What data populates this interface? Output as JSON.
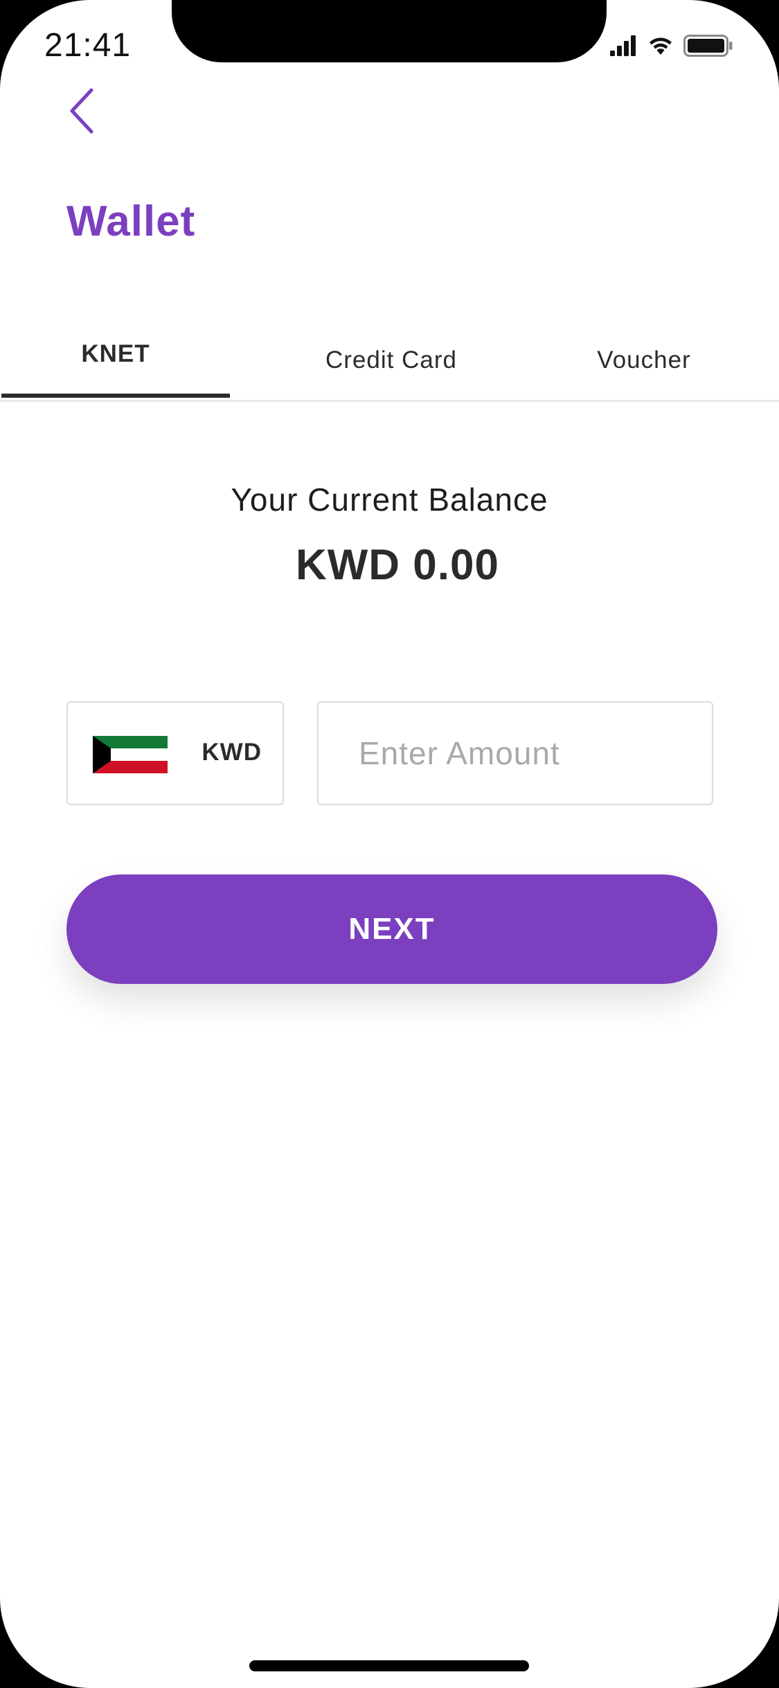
{
  "status_bar": {
    "time": "21:41",
    "icons": [
      "signal-icon",
      "wifi-icon",
      "battery-icon"
    ]
  },
  "header": {
    "back_icon": "chevron-left-icon",
    "title": "Wallet"
  },
  "tabs": [
    {
      "label": "KNET",
      "active": true
    },
    {
      "label": "Credit Card",
      "active": false
    },
    {
      "label": "Voucher",
      "active": false
    }
  ],
  "balance": {
    "label": "Your Current Balance",
    "value": "KWD 0.00"
  },
  "currency": {
    "code": "KWD",
    "flag_icon": "kuwait-flag-icon"
  },
  "amount": {
    "value": "",
    "placeholder": "Enter Amount"
  },
  "next_button": {
    "label": "NEXT"
  },
  "colors": {
    "accent": "#7b3fc0",
    "text": "#2b2b2b",
    "border": "#dcdcdc",
    "placeholder": "#a9a9a9"
  }
}
